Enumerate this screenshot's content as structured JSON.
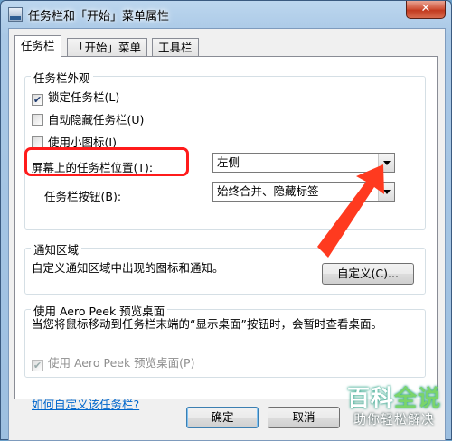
{
  "window": {
    "title": "任务栏和「开始」菜单属性",
    "close_label": "✕"
  },
  "tabs": [
    {
      "label": "任务栏",
      "active": true
    },
    {
      "label": "「开始」菜单",
      "active": false
    },
    {
      "label": "工具栏",
      "active": false
    }
  ],
  "appearance": {
    "group_title": "任务栏外观",
    "lock_label": "锁定任务栏(L)",
    "lock_checked": true,
    "autohide_label": "自动隐藏任务栏(U)",
    "autohide_checked": false,
    "small_icons_label": "使用小图标(I)",
    "small_icons_checked": false,
    "location_label": "屏幕上的任务栏位置(T):",
    "location_value": "左侧",
    "buttons_label": "任务栏按钮(B):",
    "buttons_value": "始终合并、隐藏标签"
  },
  "notification": {
    "group_title": "通知区域",
    "description": "自定义通知区域中出现的图标和通知。",
    "customize_label": "自定义(C)..."
  },
  "aero_peek": {
    "group_title": "使用 Aero Peek 预览桌面",
    "description": "当您将鼠标移动到任务栏末端的“显示桌面”按钮时，会暂时查看桌面。",
    "checkbox_label": "使用 Aero Peek 预览桌面(P)",
    "checked": true,
    "enabled": false
  },
  "help_link": "如何自定义该任务栏?",
  "footer": {
    "ok_label": "确定",
    "cancel_label": "取消"
  },
  "watermark": {
    "main_a": "百科",
    "main_b": "全说",
    "sub": "助你轻松解决"
  },
  "colors": {
    "highlight": "#ff1b1b",
    "arrow": "#ff3a1f",
    "link": "#0066cc"
  }
}
